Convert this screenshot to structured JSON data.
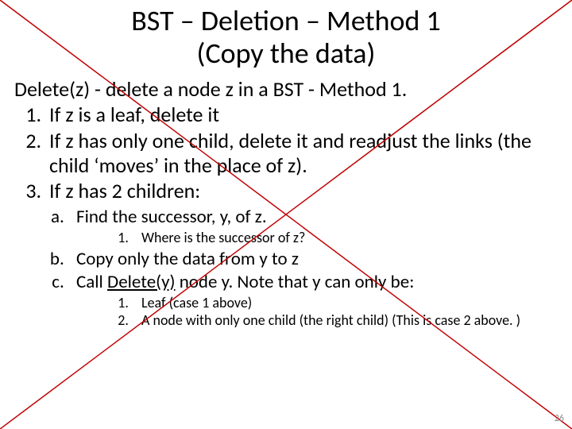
{
  "title_line1": "BST – Deletion – Method 1",
  "title_line2": "(Copy the data)",
  "desc": "Delete(z)  - delete a node z in a BST - Method 1.",
  "steps": {
    "s1": "If z is a leaf, delete it",
    "s2": "If z has only one child, delete it and readjust the links (the child ‘moves’ in the place of z).",
    "s3": "If z has 2 children:"
  },
  "sub": {
    "a": "Find the successor, y, of z.",
    "a1": "Where is the successor of z?",
    "b": "Copy only the data from y to z",
    "c_prefix": "Call ",
    "c_ul": "Delete(y)",
    "c_suffix": " node y. Note that y can only be:",
    "c1": "Leaf  (case 1 above)",
    "c2": "A node with only one child (the right child) (This is case 2 above. )"
  },
  "page": "26"
}
